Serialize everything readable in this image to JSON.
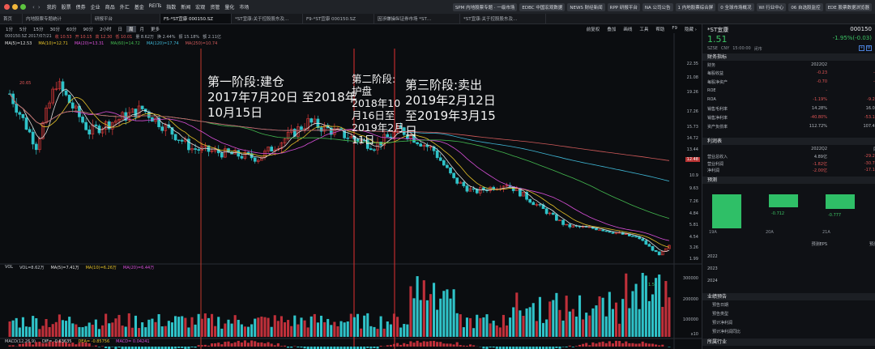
{
  "window": {
    "nav_back": "‹",
    "nav_forward": "›",
    "menu": [
      "我的",
      "股票",
      "债券",
      "企业",
      "商品",
      "外汇",
      "基金",
      "REITs",
      "指数",
      "新闻",
      "宏观",
      "资管",
      "量化",
      "市场"
    ],
    "quick_tabs": [
      "SPM 内地股票专题 · 一级市场",
      "EDBC 中国宏观数据",
      "NEWS 财经新闻",
      "RPP 研报平台",
      "NA 公司公告",
      "1 内地股票综合屏",
      "0 全球市场概况",
      "WI 行业中心",
      "06 自选股监控",
      "EDE 股票数据浏览器"
    ]
  },
  "doc_tabs": [
    "首页",
    "内地股票专题统计",
    "研报平台",
    "F5-*ST宜康 000150.SZ",
    "*ST宜康:关于控股股东及…",
    "F9-*ST宜康 000150.SZ",
    "因涉嫌操纵证券市场 *ST…",
    "*ST宜康:关于控股股东及…"
  ],
  "chart": {
    "periods": [
      "1分",
      "5分",
      "15分",
      "30分",
      "60分",
      "90分",
      "2小时",
      "日",
      "周",
      "月",
      "更多"
    ],
    "selected_period": "周",
    "tools": [
      "前复权",
      "叠加",
      "画线",
      "工具",
      "帮助",
      "F9",
      "隐藏 ›"
    ],
    "info": [
      "000150.SZ 2017/07/21",
      "收 10.53",
      "开 10.15",
      "高 12.30",
      "低 10.01",
      "量 8.62万",
      "换 2.44%",
      "振 15.18%",
      "额 2.11亿"
    ],
    "ma": [
      {
        "label": "MA(5)=12.53",
        "color": "#e0e0e0"
      },
      {
        "label": "MA(10)=12.71",
        "color": "#e6c229"
      },
      {
        "label": "MA(20)=13.31",
        "color": "#d84fd8"
      },
      {
        "label": "MA(60)=14.72",
        "color": "#43b84f"
      },
      {
        "label": "MA(120)=17.74",
        "color": "#3fb7d6"
      },
      {
        "label": "MA(250)=10.74",
        "color": "#d05a5a"
      }
    ],
    "price_ticks": [
      "22.35",
      "21.08",
      "19.26",
      "17.26",
      "15.73",
      "14.72",
      "13.44",
      "12.48",
      "10.9",
      "9.63",
      "7.26",
      "4.84",
      "5.81",
      "4.54",
      "3.26",
      "1.99"
    ],
    "last_price_tag": "12.48",
    "hi_label": "20.65",
    "lo_label": "1.56",
    "vol": [
      {
        "label": "VOL",
        "color": "#c8ccd2"
      },
      {
        "label": "VOL=8.62万",
        "color": "#c8ccd2"
      },
      {
        "label": "MA(5)=7.41万",
        "color": "#e0e0e0"
      },
      {
        "label": "MA(10)=6.26万",
        "color": "#e6c229"
      },
      {
        "label": "MA(20)=6.44万",
        "color": "#d84fd8"
      }
    ],
    "vol_ticks": [
      "300000",
      "200000",
      "100000",
      "x10"
    ],
    "macd": [
      {
        "label": "MACD(12,26,9)",
        "color": "#c8ccd2"
      },
      {
        "label": "DIF= -0.63635",
        "color": "#e0e0e0"
      },
      {
        "label": "DEA= -0.85756",
        "color": "#e6c229"
      },
      {
        "label": "MACD= 0.04241",
        "color": "#d84fd8"
      }
    ]
  },
  "annotations": {
    "phase1": [
      "第一阶段:建仓",
      "2017年7月20日 至2018年",
      "10月15日"
    ],
    "phase2": [
      "第二阶段:",
      "护盘",
      "2018年10",
      "月16日至",
      "2019年2月",
      "11日"
    ],
    "phase3": [
      "第三阶段:卖出",
      "2019年2月12日",
      "至2019年3月15",
      "日"
    ]
  },
  "quote": {
    "name": "*ST宜康",
    "code": "000150",
    "price": "1.51",
    "change": "-1.95%(-0.03)",
    "sub": [
      "SZSE",
      "CNY",
      "15:00:00",
      "闭市"
    ],
    "finance_title": "财务指标",
    "finance_header": [
      "财务",
      "2022Q2",
      "2"
    ],
    "finance_rows": [
      [
        "每股收益",
        "-0.23",
        "-0"
      ],
      [
        "每股净资产",
        "-0.70",
        "-0"
      ],
      [
        "ROE",
        "-",
        ""
      ],
      [
        "ROA",
        "-1.19%",
        "-9.23"
      ],
      [
        "销售毛利率",
        "14.28%",
        "16.05"
      ],
      [
        "销售净利率",
        "-40.80%",
        "-53.11"
      ],
      [
        "资产负债率",
        "112.72%",
        "107.41"
      ]
    ],
    "income_title": "利润表",
    "income_header": [
      "",
      "2022Q2",
      "同"
    ],
    "income_rows": [
      [
        "营业总收入",
        "4.89亿",
        "-29.27"
      ],
      [
        "营业利润",
        "-1.82亿",
        "-30.79"
      ],
      [
        "净利润",
        "-2.00亿",
        "-17.11"
      ]
    ],
    "forecast_title": "预测",
    "forecast_values": [
      "-0.712",
      "-0.777"
    ],
    "forecast_years": [
      "19A",
      "20A",
      "21A"
    ],
    "eps_header": [
      "预测EPS",
      "预测"
    ],
    "eps_years": [
      "2022",
      "2023",
      "2024"
    ],
    "perf_title": "业绩预告",
    "perf_rows": [
      "预告日期",
      "预告类型",
      "预计净利润",
      "预计净利润同比"
    ],
    "industry_title": "所属行业"
  }
}
